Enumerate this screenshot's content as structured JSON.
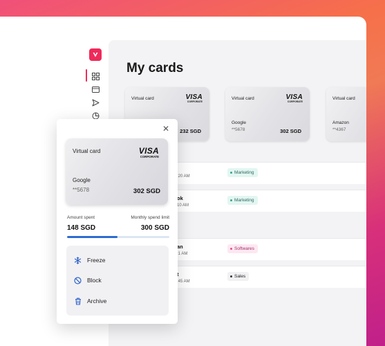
{
  "page": {
    "title": "My cards"
  },
  "colors": {
    "brand": "#ee2a5a",
    "progress": "#2c6cd0",
    "action_icon": "#2f63c8"
  },
  "sidebar": {
    "items": [
      {
        "name": "dashboard-icon",
        "active": true
      },
      {
        "name": "card-icon"
      },
      {
        "name": "send-icon"
      },
      {
        "name": "pie-chart-icon"
      }
    ]
  },
  "cards": [
    {
      "type": "Virtual card",
      "brand": "VISA",
      "brand_sub": "CORPORATE",
      "name": "",
      "number": "",
      "amount": "232 SGD"
    },
    {
      "type": "Virtual card",
      "brand": "VISA",
      "brand_sub": "CORPORATE",
      "name": "Google",
      "number": "**5678",
      "amount": "302 SGD"
    },
    {
      "type": "Virtual card",
      "brand": "",
      "brand_sub": "",
      "name": "Amazon",
      "number": "**4367",
      "amount": ""
    }
  ],
  "transactions": [
    {
      "title": "",
      "time": ":20 AM",
      "tag": "Marketing",
      "tag_color": "#e3f6f1",
      "tag_text": "#2f6a5e",
      "tag_dot": "#3aa58a"
    },
    {
      "title": "ok",
      "time": "10 AM",
      "tag": "Marketing",
      "tag_color": "#e3f6f1",
      "tag_text": "#2f6a5e",
      "tag_dot": "#3aa58a"
    },
    {
      "title": "an",
      "time": ":1 AM",
      "tag": "Softwares",
      "tag_color": "#fde8f1",
      "tag_text": "#a3306a",
      "tag_dot": "#e0508f"
    },
    {
      "title": "t",
      "time": ":45 AM",
      "tag": "Sales",
      "tag_color": "#f1f1f3",
      "tag_text": "#222222",
      "tag_dot": "#333333"
    }
  ],
  "popup": {
    "card": {
      "type": "Virtual card",
      "brand": "VISA",
      "brand_sub": "CORPORATE",
      "name": "Google",
      "number": "**5678",
      "amount": "302 SGD"
    },
    "amount_spent_label": "Amount spent",
    "amount_spent": "148 SGD",
    "limit_label": "Monthly spend limit",
    "limit": "300 SGD",
    "progress_fraction": 0.49,
    "actions": [
      {
        "label": "Freeze",
        "icon": "snowflake-icon"
      },
      {
        "label": "Block",
        "icon": "block-icon"
      },
      {
        "label": "Archive",
        "icon": "trash-icon"
      }
    ]
  }
}
